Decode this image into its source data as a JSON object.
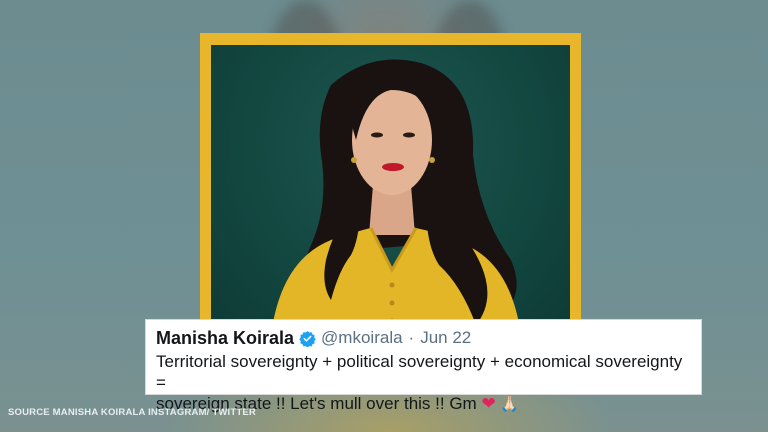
{
  "tweet": {
    "name": "Manisha Koirala",
    "handle": "@mkoirala",
    "separator": "·",
    "date": "Jun 22",
    "text_line1": "Territorial sovereignty + political sovereignty + economical sovereignty =",
    "text_line2": "sovereign state !! Let's mull over this !! Gm",
    "emoji_heart": "❤",
    "emoji_pray": "🙏🏻",
    "verified_icon": "verified-badge-icon"
  },
  "caption": {
    "source": "SOURCE MANISHA KOIRALA INSTAGRAM/ TWITTER"
  },
  "colors": {
    "background": "#6f8f92",
    "frame": "#e7b62a",
    "photo_bg": "#134841",
    "verified": "#1da1f2",
    "heart": "#e0245e"
  }
}
